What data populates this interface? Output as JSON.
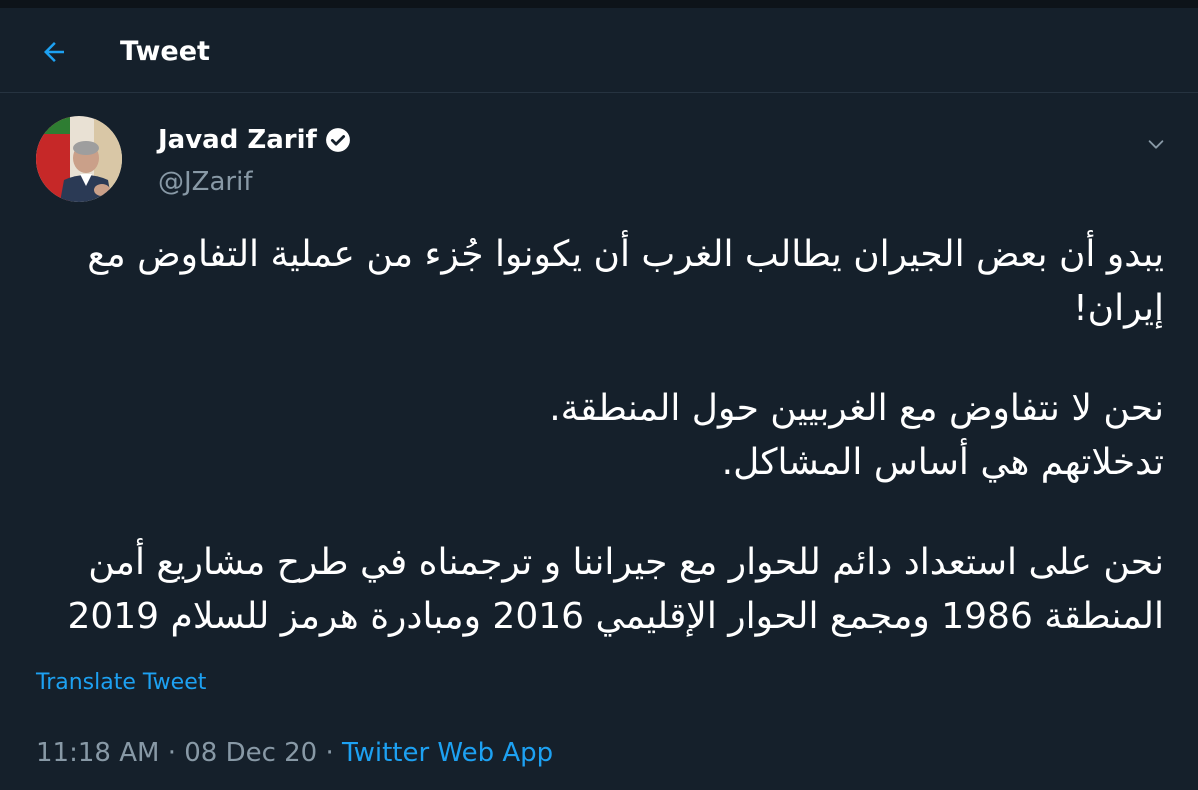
{
  "header": {
    "title": "Tweet"
  },
  "author": {
    "name": "Javad Zarif",
    "handle": "@JZarif"
  },
  "tweet": {
    "paragraph1": "يبدو أن بعض الجيران يطالب الغرب أن يكونوا جُزء من عملية التفاوض مع إيران!",
    "paragraph2_line1": "نحن لا نتفاوض مع الغربيين حول المنطقة.",
    "paragraph2_line2": "تدخلاتهم هي أساس المشاكل.",
    "paragraph3": "نحن على استعداد دائم للحوار مع جيراننا و ترجمناه في طرح مشاريع أمن المنطقة 1986 ومجمع الحوار الإقليمي 2016 ومبادرة هرمز للسلام 2019"
  },
  "translate_label": "Translate Tweet",
  "meta": {
    "time": "11:18 AM",
    "separator": "·",
    "date": "08 Dec 20",
    "source": "Twitter Web App"
  },
  "colors": {
    "background": "#15202b",
    "accent": "#1da1f2",
    "secondary_text": "#8899a6"
  },
  "icons": {
    "back": "arrow-left-icon",
    "verified": "verified-badge-icon",
    "caret": "chevron-down-icon"
  }
}
